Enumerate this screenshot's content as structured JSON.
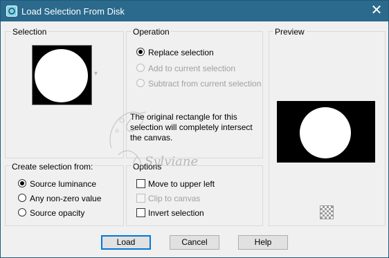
{
  "window": {
    "title": "Load Selection From Disk",
    "close_glyph": "✕",
    "icon": "selection-app-icon"
  },
  "selection_panel": {
    "title": "Selection"
  },
  "operation_panel": {
    "title": "Operation",
    "options": [
      {
        "label": "Replace selection",
        "selected": true,
        "enabled": true
      },
      {
        "label": "Add to current selection",
        "selected": false,
        "enabled": false
      },
      {
        "label": "Subtract from current selection",
        "selected": false,
        "enabled": false
      }
    ],
    "message_line1": "The original rectangle for this",
    "message_line2": "selection will completely intersect",
    "message_line3": "the canvas."
  },
  "preview_panel": {
    "title": "Preview"
  },
  "create_panel": {
    "title": "Create selection from:",
    "options": [
      {
        "label": "Source luminance",
        "selected": true
      },
      {
        "label": "Any non-zero value",
        "selected": false
      },
      {
        "label": "Source opacity",
        "selected": false
      }
    ]
  },
  "options_panel": {
    "title": "Options",
    "checks": [
      {
        "label": "Move to upper left",
        "checked": false,
        "enabled": true
      },
      {
        "label": "Clip to canvas",
        "checked": false,
        "enabled": false
      },
      {
        "label": "Invert selection",
        "checked": false,
        "enabled": true
      }
    ]
  },
  "buttons": {
    "load": "Load",
    "cancel": "Cancel",
    "help": "Help"
  },
  "watermark": {
    "text": "Sylviane"
  },
  "colors": {
    "title_bar": "#2b6a8c",
    "default_button_border": "#0078d7",
    "disabled_text": "#a0a0a0"
  }
}
